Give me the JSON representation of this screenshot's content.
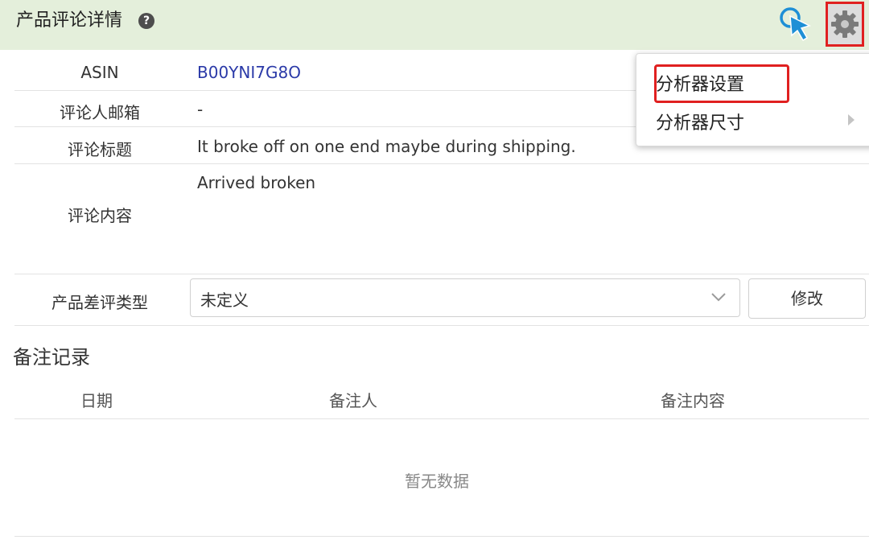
{
  "header": {
    "title": "产品评论详情",
    "help_icon": "?",
    "icons": [
      "cursor-icon",
      "gear-icon"
    ]
  },
  "details": {
    "asin_label": "ASIN",
    "asin_value": "B00YNI7G8O",
    "email_label": "评论人邮箱",
    "email_value": "-",
    "title_label": "评论标题",
    "title_value": "It broke off on one end maybe during shipping.",
    "content_label": "评论内容",
    "content_value": "Arrived broken",
    "type_label": "产品差评类型",
    "type_value": "未定义",
    "modify_button": "修改"
  },
  "notes": {
    "section_title": "备注记录",
    "columns": [
      "日期",
      "备注人",
      "备注内容"
    ],
    "empty_text": "暂无数据"
  },
  "menu": {
    "items": [
      "分析器设置",
      "分析器尺寸"
    ],
    "highlighted": "分析器设置"
  },
  "colors": {
    "header_bg": "#e4efdb",
    "link": "#2b3aa8",
    "highlight_border": "#e02020",
    "cursor_blue": "#1e8fd6"
  }
}
